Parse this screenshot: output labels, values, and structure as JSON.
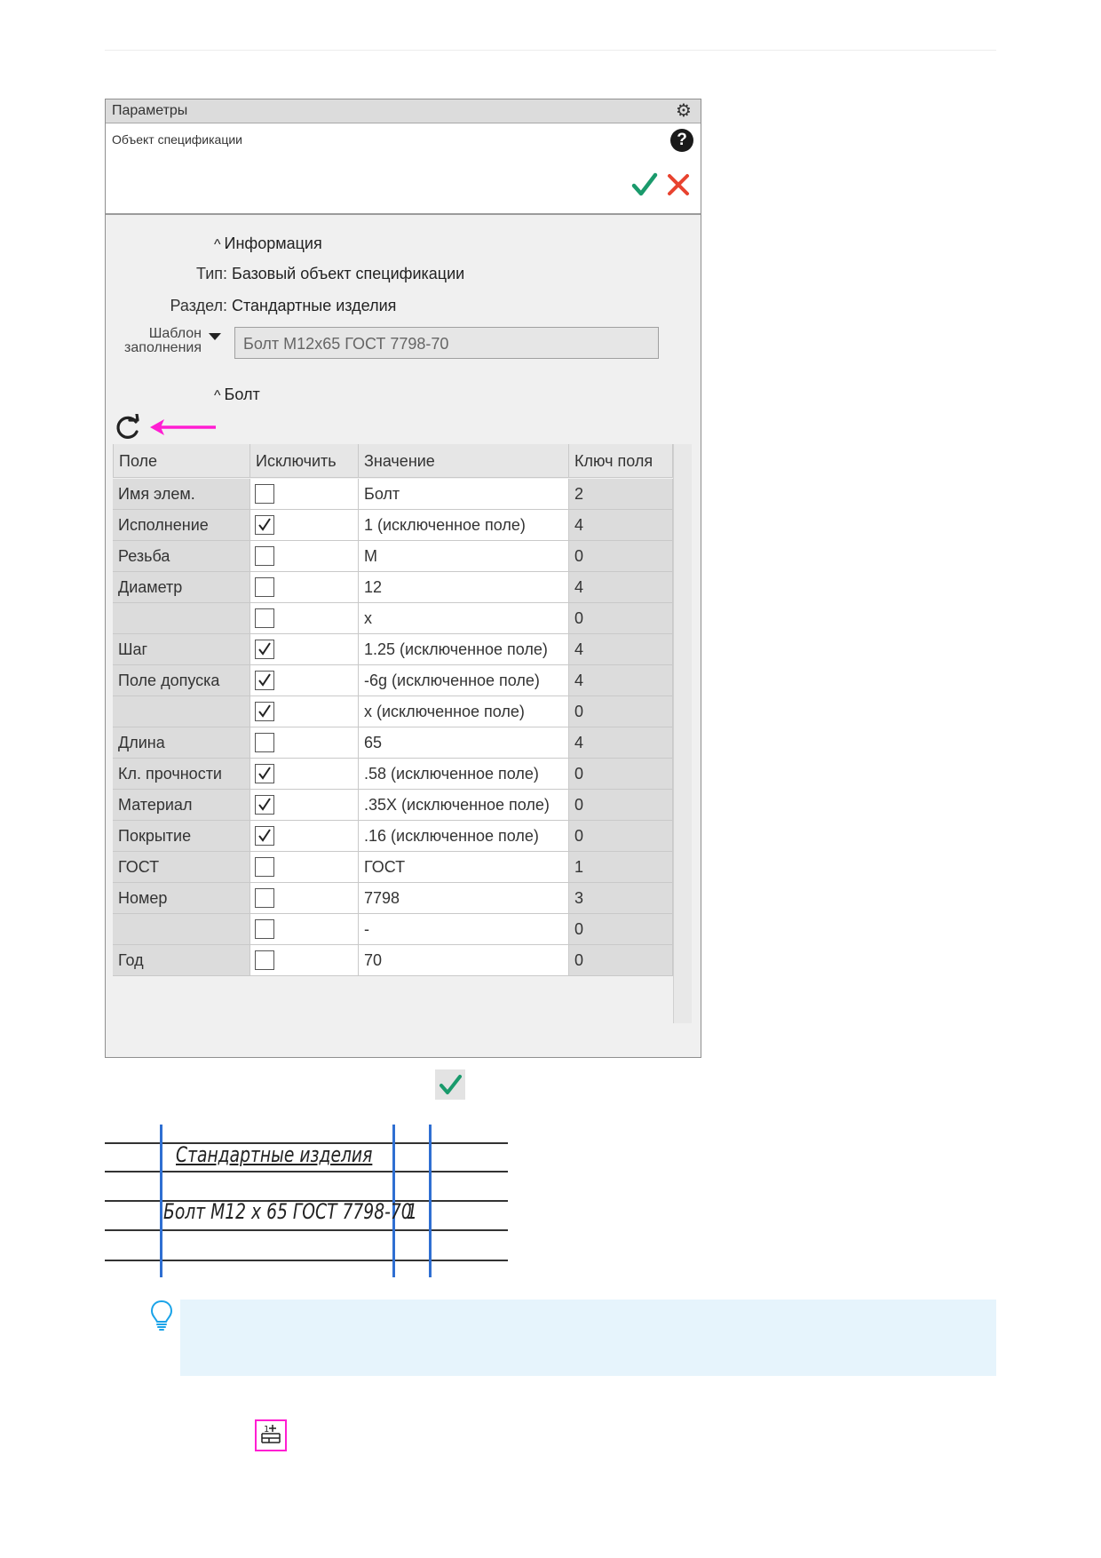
{
  "panel": {
    "title": "Параметры",
    "subtitle": "Объект спецификации"
  },
  "info": {
    "section_title": "Информация",
    "type_label": "Тип:",
    "type_value": "Базовый объект спецификации",
    "section_label": "Раздел:",
    "section_value": "Стандартные изделия",
    "template_label_line1": "Шаблон",
    "template_label_line2": "заполнения",
    "template_value": "Болт М12х65 ГОСТ 7798-70"
  },
  "bolt": {
    "section_title": "Болт"
  },
  "table": {
    "headers": [
      "Поле",
      "Исключить",
      "Значение",
      "Ключ поля"
    ],
    "rows": [
      {
        "field": "Имя элем.",
        "excluded": false,
        "value": "Болт",
        "key": "2"
      },
      {
        "field": "Исполнение",
        "excluded": true,
        "value": "1 (исключенное поле)",
        "key": "4"
      },
      {
        "field": "Резьба",
        "excluded": false,
        "value": "М",
        "key": "0"
      },
      {
        "field": "Диаметр",
        "excluded": false,
        "value": "12",
        "key": "4"
      },
      {
        "field": "",
        "excluded": false,
        "value": "х",
        "key": "0"
      },
      {
        "field": "Шаг",
        "excluded": true,
        "value": "1.25 (исключенное поле)",
        "key": "4"
      },
      {
        "field": "Поле допуска",
        "excluded": true,
        "value": "-6g (исключенное поле)",
        "key": "4"
      },
      {
        "field": "",
        "excluded": true,
        "value": "х (исключенное поле)",
        "key": "0"
      },
      {
        "field": "Длина",
        "excluded": false,
        "value": "65",
        "key": "4"
      },
      {
        "field": "Кл. прочности",
        "excluded": true,
        "value": ".58 (исключенное поле)",
        "key": "0"
      },
      {
        "field": "Материал",
        "excluded": true,
        "value": ".35Х (исключенное поле)",
        "key": "0"
      },
      {
        "field": "Покрытие",
        "excluded": true,
        "value": ".16 (исключенное поле)",
        "key": "0"
      },
      {
        "field": "ГОСТ",
        "excluded": false,
        "value": "ГОСТ",
        "key": "1"
      },
      {
        "field": "Номер",
        "excluded": false,
        "value": "7798",
        "key": "3"
      },
      {
        "field": "",
        "excluded": false,
        "value": "-",
        "key": "0"
      },
      {
        "field": "Год",
        "excluded": false,
        "value": "70",
        "key": "0"
      }
    ]
  },
  "drawing": {
    "section_name": "Стандартные изделия",
    "item_name": "Болт М12 х 65 ГОСТ 7798-70",
    "quantity": "1"
  },
  "colors": {
    "accept": "#1a9a6c",
    "cancel": "#e8432f",
    "pointer_arrow": "#ff1ed2",
    "drawing_line": "#2f6fd2",
    "note_bg": "#e6f4fc"
  },
  "icons": [
    "gear-icon",
    "help-icon",
    "check-icon",
    "close-icon",
    "refresh-icon",
    "lightbulb-icon",
    "spec-object-icon"
  ]
}
